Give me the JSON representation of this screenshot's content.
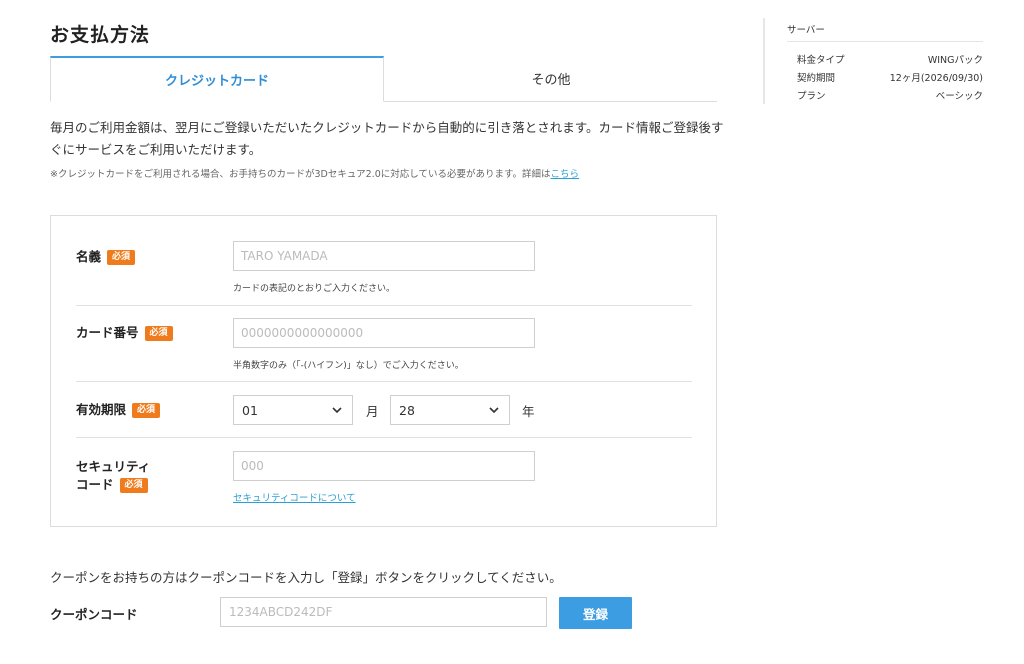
{
  "page": {
    "title": "お支払方法"
  },
  "tabs": [
    {
      "label": "クレジットカード",
      "active": true
    },
    {
      "label": "その他",
      "active": false
    }
  ],
  "intro": {
    "text": "毎月のご利用金額は、翌月にご登録いただいたクレジットカードから自動的に引き落とされます。カード情報ご登録後すぐにサービスをご利用いただけます。",
    "note": "※クレジットカードをご利用される場合、お手持ちのカードが3Dセキュア2.0に対応している必要があります。詳細は",
    "note_link": "こちら"
  },
  "required_badge": "必須",
  "form": {
    "name": {
      "label": "名義",
      "placeholder": "TARO YAMADA",
      "help": "カードの表記のとおりご入力ください。"
    },
    "card_number": {
      "label": "カード番号",
      "placeholder": "0000000000000000",
      "help": "半角数字のみ（「-(ハイフン)」なし）でご入力ください。"
    },
    "expiry": {
      "label": "有効期限",
      "month": "01",
      "month_unit": "月",
      "year": "28",
      "year_unit": "年"
    },
    "security": {
      "label_line1": "セキュリティ",
      "label_line2": "コード",
      "placeholder": "000",
      "link": "セキュリティコードについて"
    }
  },
  "coupon": {
    "description": "クーポンをお持ちの方はクーポンコードを入力し「登録」ボタンをクリックしてください。",
    "label": "クーポンコード",
    "placeholder": "1234ABCD242DF",
    "button": "登録"
  },
  "sidebar": {
    "title": "サーバー",
    "rows": [
      {
        "key": "料金タイプ",
        "value": "WINGパック"
      },
      {
        "key": "契約期間",
        "value": "12ヶ月(2026/09/30)"
      },
      {
        "key": "プラン",
        "value": "ベーシック"
      }
    ]
  },
  "colors": {
    "accent": "#3d9de2",
    "required": "#f07b1c",
    "link": "#2a9fd6"
  }
}
